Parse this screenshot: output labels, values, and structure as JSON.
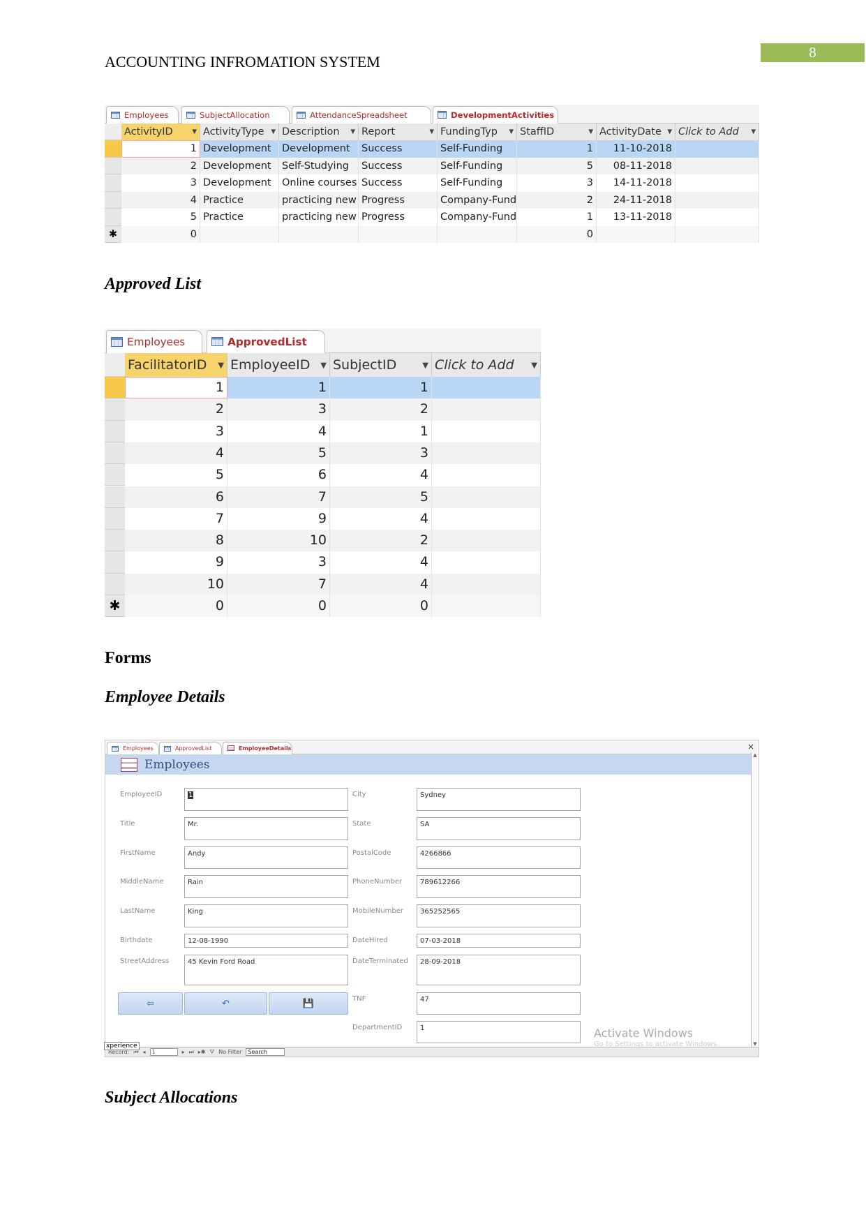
{
  "header": {
    "title": "ACCOUNTING INFROMATION SYSTEM",
    "page_number": "8",
    "page_number_color": "#9bbb59"
  },
  "table1": {
    "tabs": [
      {
        "label": "Employees"
      },
      {
        "label": "SubjectAllocation"
      },
      {
        "label": "AttendanceSpreadsheet"
      },
      {
        "label": "DevelopmentActivities",
        "active": true
      }
    ],
    "columns": [
      "ActivityID",
      "ActivityType",
      "Description",
      "Report",
      "FundingTyp",
      "StaffID",
      "ActivityDate",
      "Click to Add"
    ],
    "rows": [
      [
        "1",
        "Development",
        "Development",
        "Success",
        "Self-Funding",
        "1",
        "11-10-2018",
        ""
      ],
      [
        "2",
        "Development",
        "Self-Studying",
        "Success",
        "Self-Funding",
        "5",
        "08-11-2018",
        ""
      ],
      [
        "3",
        "Development",
        "Online courses",
        "Success",
        "Self-Funding",
        "3",
        "14-11-2018",
        ""
      ],
      [
        "4",
        "Practice",
        "practicing new",
        "Progress",
        "Company-Funding",
        "2",
        "24-11-2018",
        ""
      ],
      [
        "5",
        "Practice",
        "practicing new",
        "Progress",
        "Company-Funding",
        "1",
        "13-11-2018",
        ""
      ]
    ],
    "new_row": [
      "0",
      "",
      "",
      "",
      "",
      "0",
      "",
      ""
    ],
    "new_row_marker": "✱"
  },
  "section_approved": "Approved List",
  "table2": {
    "tabs": [
      {
        "label": "Employees"
      },
      {
        "label": "ApprovedList",
        "active": true
      }
    ],
    "columns": [
      "FacilitatorID",
      "EmployeeID",
      "SubjectID",
      "Click to Add"
    ],
    "rows": [
      [
        "1",
        "1",
        "1"
      ],
      [
        "2",
        "3",
        "2"
      ],
      [
        "3",
        "4",
        "1"
      ],
      [
        "4",
        "5",
        "3"
      ],
      [
        "5",
        "6",
        "4"
      ],
      [
        "6",
        "7",
        "5"
      ],
      [
        "7",
        "9",
        "4"
      ],
      [
        "8",
        "10",
        "2"
      ],
      [
        "9",
        "3",
        "4"
      ],
      [
        "10",
        "7",
        "4"
      ]
    ],
    "new_row": [
      "0",
      "0",
      "0"
    ],
    "new_row_marker": "✱"
  },
  "section_forms": "Forms",
  "section_employee_details": "Employee Details",
  "form": {
    "tabs": [
      {
        "label": "Employees"
      },
      {
        "label": "ApprovedList"
      },
      {
        "label": "EmployeeDetails",
        "active": true
      }
    ],
    "close": "×",
    "title": "Employees",
    "left_fields": [
      {
        "label": "EmployeeID",
        "value": "1"
      },
      {
        "label": "Title",
        "value": "Mr."
      },
      {
        "label": "FirstName",
        "value": "Andy"
      },
      {
        "label": "MiddleName",
        "value": "Rain"
      },
      {
        "label": "LastName",
        "value": "King"
      },
      {
        "label": "Birthdate",
        "value": "12-08-1990"
      },
      {
        "label": "StreetAddress",
        "value": "45 Kevin Ford Road"
      }
    ],
    "right_fields": [
      {
        "label": "City",
        "value": "Sydney"
      },
      {
        "label": "State",
        "value": "SA"
      },
      {
        "label": "PostalCode",
        "value": "4266866"
      },
      {
        "label": "PhoneNumber",
        "value": "789612266"
      },
      {
        "label": "MobileNumber",
        "value": "365252565"
      },
      {
        "label": "DateHired",
        "value": "07-03-2018"
      },
      {
        "label": "DateTerminated",
        "value": "28-09-2018"
      },
      {
        "label": "TNF",
        "value": "47"
      },
      {
        "label": "DepartmentID",
        "value": "1"
      }
    ],
    "buttons": [
      {
        "icon": "exit-icon",
        "glyph": "⇦"
      },
      {
        "icon": "undo-icon",
        "glyph": "↶"
      },
      {
        "icon": "save-icon",
        "glyph": "💾"
      }
    ],
    "nav": {
      "tooltip": "xperience",
      "record_label": "Record:",
      "record_value": "1",
      "filter": "No Filter",
      "search": "Search"
    },
    "watermark": {
      "line1": "Activate Windows",
      "line2": "Go to Settings to activate Windows."
    }
  },
  "section_subject_allocations": "Subject Allocations"
}
